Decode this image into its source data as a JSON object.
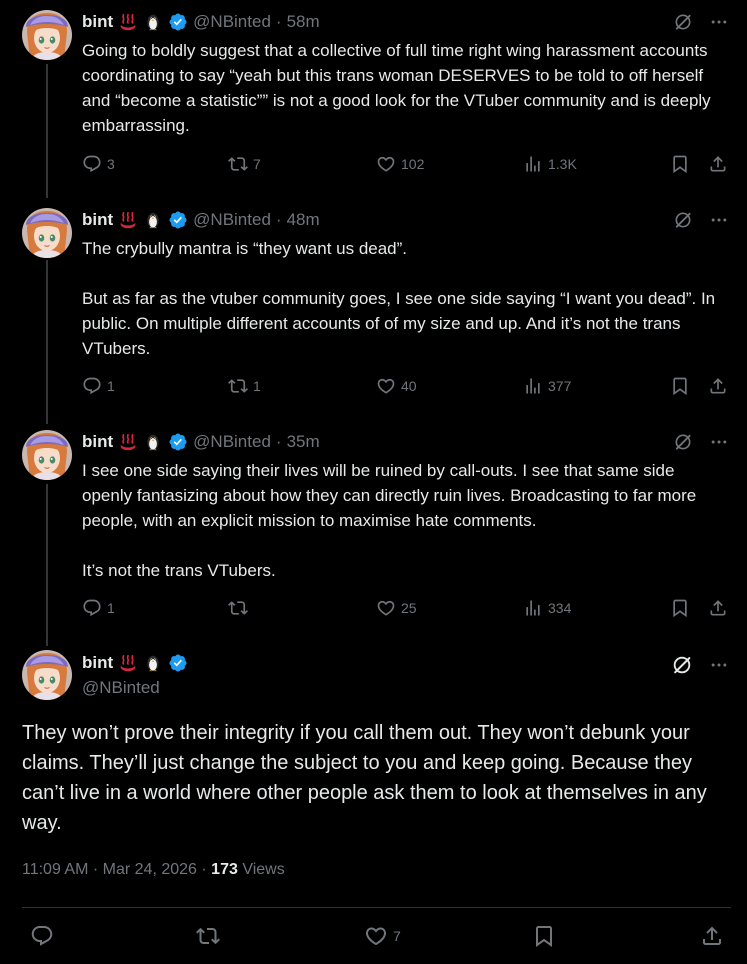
{
  "colors": {
    "background": "#000000",
    "text": "#e7e9ea",
    "muted": "#71767b",
    "verified": "#1d9bf0"
  },
  "author": {
    "name": "bint",
    "handle": "@NBinted",
    "badges": [
      "hot-springs-icon",
      "penguin-icon",
      "verified-icon"
    ]
  },
  "tweets": [
    {
      "time": "58m",
      "paragraphs": [
        "Going to boldly suggest that a collective of full time right wing harassment accounts coordinating to say “yeah but this trans woman DESERVES to be told to off herself and “become a statistic”” is not a good look for the VTuber community and is deeply embarrassing."
      ],
      "replies": "3",
      "reposts": "7",
      "likes": "102",
      "views": "1.3K"
    },
    {
      "time": "48m",
      "paragraphs": [
        "The crybully mantra is “they want us dead”.",
        "But as far as the vtuber community goes, I see one side saying “I want you dead”. In public. On multiple different accounts of of my size and up. And it’s not the trans VTubers."
      ],
      "replies": "1",
      "reposts": "1",
      "likes": "40",
      "views": "377"
    },
    {
      "time": "35m",
      "paragraphs": [
        "I see one side saying their lives will be ruined by call-outs. I see that same side openly fantasizing about how they can directly ruin lives. Broadcasting to far more people, with an explicit mission to maximise hate comments.",
        "It’s not the trans VTubers."
      ],
      "replies": "1",
      "reposts": "",
      "likes": "25",
      "views": "334"
    }
  ],
  "main": {
    "text": "They won’t prove their integrity if you call them out. They won’t debunk your claims. They’ll just change the subject to you and keep going. Because they can’t live in a world where other people ask them to look at themselves in any way.",
    "time": "11:09 AM",
    "date": "Mar 24, 2026",
    "separator": "·",
    "views_count": "173",
    "views_label": "Views",
    "likes": "7"
  }
}
